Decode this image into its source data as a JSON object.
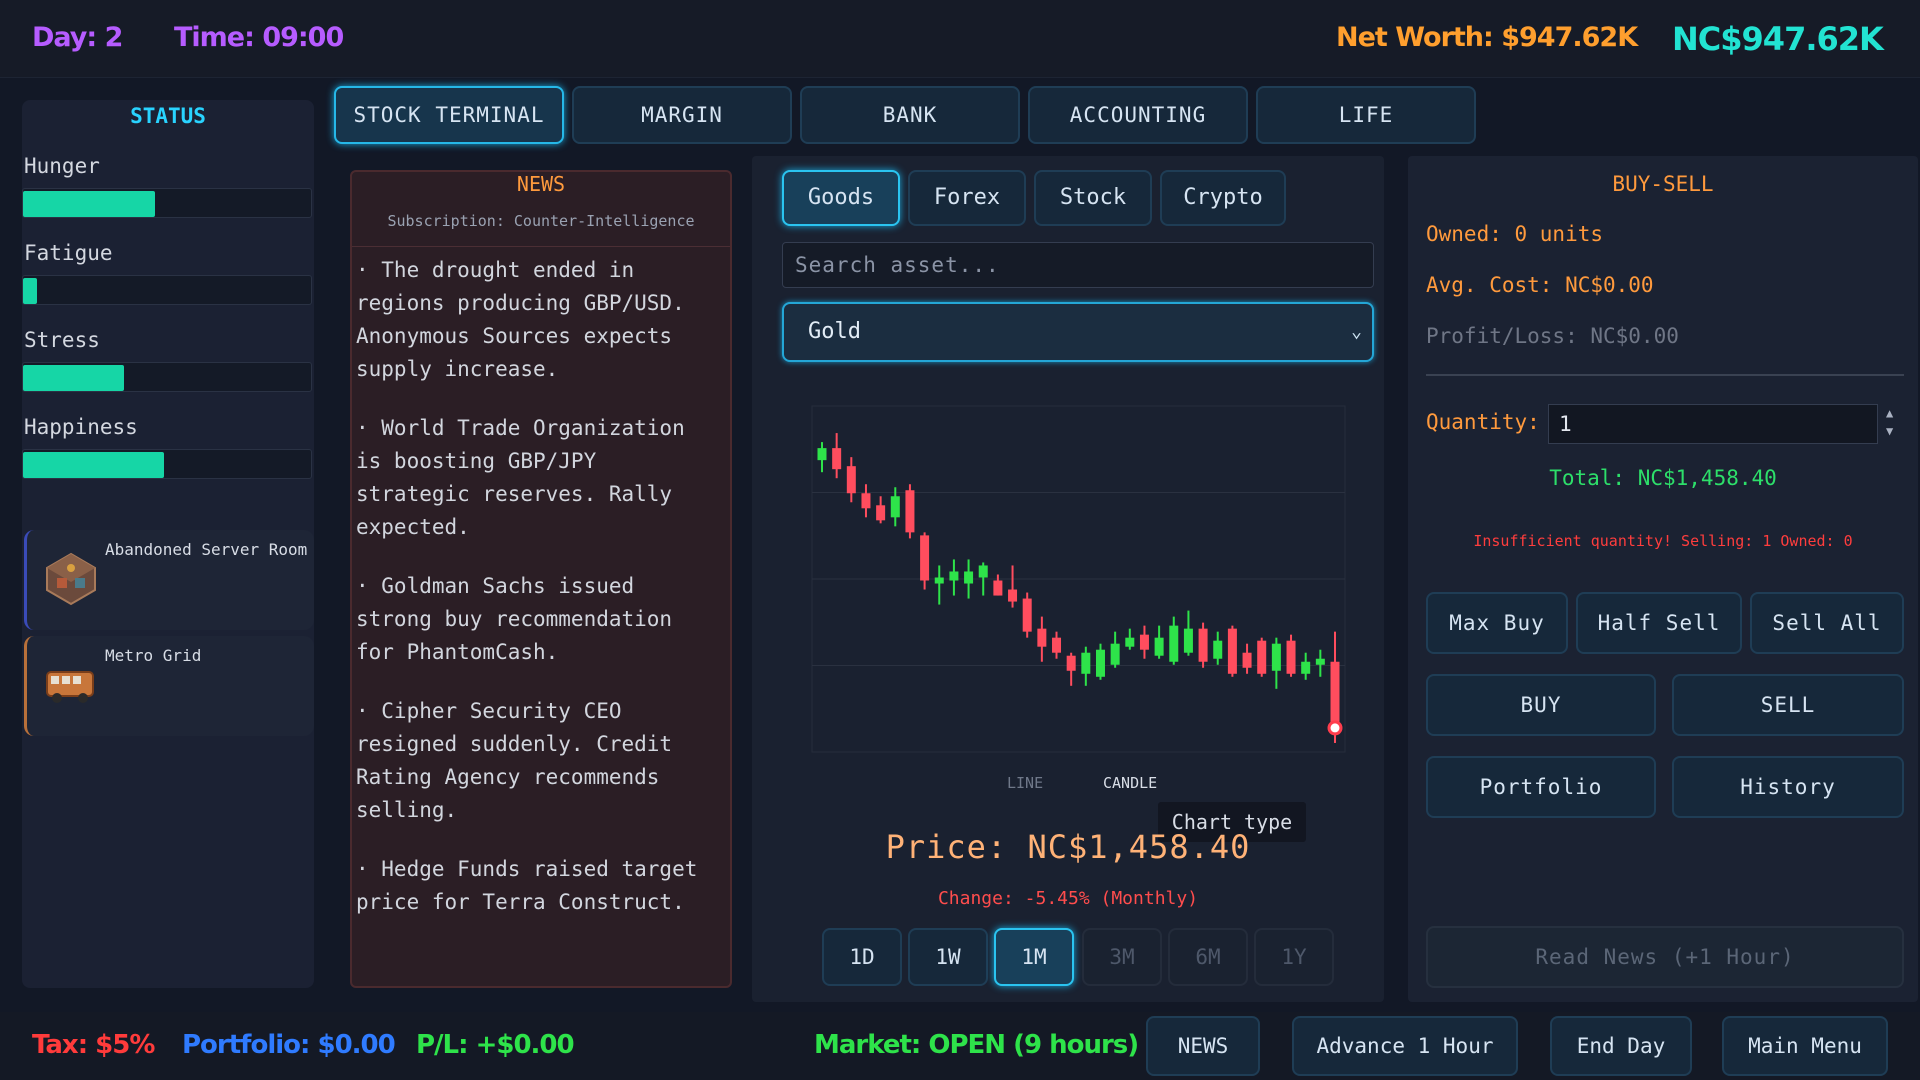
{
  "topbar": {
    "day": "Day: 2",
    "time": "Time: 09:00",
    "net_worth": "Net Worth: $947.62K",
    "nc_balance": "NC$947.62K"
  },
  "status": {
    "title": "STATUS",
    "stats": [
      {
        "label": "Hunger",
        "value": 0.46
      },
      {
        "label": "Fatigue",
        "value": 0.05
      },
      {
        "label": "Stress",
        "value": 0.35
      },
      {
        "label": "Happiness",
        "value": 0.49
      }
    ],
    "locations": [
      {
        "name": "Abandoned Server Room",
        "icon": "server-room-icon",
        "accent": "#3a4bb8"
      },
      {
        "name": "Metro Grid",
        "icon": "metro-bus-icon",
        "accent": "#b8703a"
      }
    ]
  },
  "tabs": [
    "STOCK TERMINAL",
    "MARGIN",
    "BANK",
    "ACCOUNTING",
    "LIFE"
  ],
  "news": {
    "title": "NEWS",
    "subscription": "Subscription: Counter-Intelligence",
    "items": [
      "· The drought ended in regions producing GBP/USD. Anonymous Sources expects supply increase.",
      "· World Trade Organization is boosting GBP/JPY strategic reserves. Rally expected.",
      "· Goldman Sachs issued strong buy recommendation for PhantomCash.",
      "· Cipher Security CEO resigned suddenly. Credit Rating Agency recommends selling.",
      "· Hedge Funds raised target price for Terra Construct."
    ]
  },
  "market": {
    "subtabs": [
      "Goods",
      "Forex",
      "Stock",
      "Crypto"
    ],
    "search_placeholder": "Search asset...",
    "selected_asset": "Gold",
    "chart_type_line": "LINE",
    "chart_type_candle": "CANDLE",
    "tooltip": "Chart type",
    "price": "Price: NC$1,458.40",
    "change": "Change: -5.45% (Monthly)",
    "ranges": [
      "1D",
      "1W",
      "1M",
      "3M",
      "6M",
      "1Y"
    ]
  },
  "chart_data": {
    "type": "candlestick",
    "title": "",
    "xlabel": "",
    "ylabel": "",
    "ylim": [
      1440,
      1555
    ],
    "candles": [
      {
        "o": 1537,
        "h": 1543,
        "l": 1533,
        "c": 1541
      },
      {
        "o": 1541,
        "h": 1546,
        "l": 1531,
        "c": 1534
      },
      {
        "o": 1535,
        "h": 1538,
        "l": 1523,
        "c": 1526
      },
      {
        "o": 1526,
        "h": 1529,
        "l": 1518,
        "c": 1521
      },
      {
        "o": 1522,
        "h": 1525,
        "l": 1516,
        "c": 1517
      },
      {
        "o": 1518,
        "h": 1528,
        "l": 1515,
        "c": 1525
      },
      {
        "o": 1527,
        "h": 1529,
        "l": 1511,
        "c": 1513
      },
      {
        "o": 1512,
        "h": 1513,
        "l": 1494,
        "c": 1497
      },
      {
        "o": 1496,
        "h": 1502,
        "l": 1489,
        "c": 1498
      },
      {
        "o": 1497,
        "h": 1504,
        "l": 1492,
        "c": 1500
      },
      {
        "o": 1496,
        "h": 1504,
        "l": 1491,
        "c": 1500
      },
      {
        "o": 1498,
        "h": 1503,
        "l": 1492,
        "c": 1502
      },
      {
        "o": 1497,
        "h": 1499,
        "l": 1492,
        "c": 1492
      },
      {
        "o": 1494,
        "h": 1502,
        "l": 1488,
        "c": 1490
      },
      {
        "o": 1491,
        "h": 1493,
        "l": 1478,
        "c": 1480
      },
      {
        "o": 1481,
        "h": 1485,
        "l": 1470,
        "c": 1475
      },
      {
        "o": 1478,
        "h": 1480,
        "l": 1471,
        "c": 1473
      },
      {
        "o": 1472,
        "h": 1473,
        "l": 1462,
        "c": 1467
      },
      {
        "o": 1466,
        "h": 1475,
        "l": 1462,
        "c": 1473
      },
      {
        "o": 1465,
        "h": 1476,
        "l": 1464,
        "c": 1474
      },
      {
        "o": 1469,
        "h": 1480,
        "l": 1468,
        "c": 1476
      },
      {
        "o": 1475,
        "h": 1481,
        "l": 1474,
        "c": 1478
      },
      {
        "o": 1479,
        "h": 1482,
        "l": 1471,
        "c": 1474
      },
      {
        "o": 1472,
        "h": 1482,
        "l": 1471,
        "c": 1478
      },
      {
        "o": 1470,
        "h": 1485,
        "l": 1469,
        "c": 1482
      },
      {
        "o": 1473,
        "h": 1487,
        "l": 1472,
        "c": 1481
      },
      {
        "o": 1481,
        "h": 1483,
        "l": 1468,
        "c": 1470
      },
      {
        "o": 1471,
        "h": 1480,
        "l": 1469,
        "c": 1477
      },
      {
        "o": 1481,
        "h": 1482,
        "l": 1465,
        "c": 1466
      },
      {
        "o": 1473,
        "h": 1476,
        "l": 1466,
        "c": 1468
      },
      {
        "o": 1477,
        "h": 1478,
        "l": 1465,
        "c": 1466
      },
      {
        "o": 1467,
        "h": 1478,
        "l": 1461,
        "c": 1476
      },
      {
        "o": 1477,
        "h": 1479,
        "l": 1465,
        "c": 1466
      },
      {
        "o": 1466,
        "h": 1473,
        "l": 1464,
        "c": 1470
      },
      {
        "o": 1469,
        "h": 1474,
        "l": 1465,
        "c": 1471
      },
      {
        "o": 1470,
        "h": 1480,
        "l": 1443,
        "c": 1448
      }
    ],
    "last_marker": 1448
  },
  "buysell": {
    "title": "BUY-SELL",
    "owned": "Owned: 0 units",
    "avg_cost": "Avg. Cost: NC$0.00",
    "profit_loss": "Profit/Loss: NC$0.00",
    "quantity_label": "Quantity:",
    "quantity_value": "1",
    "total": "Total: NC$1,458.40",
    "warning": "Insufficient quantity! Selling: 1 Owned: 0",
    "max_buy": "Max Buy",
    "half_sell": "Half Sell",
    "sell_all": "Sell All",
    "buy": "BUY",
    "sell": "SELL",
    "portfolio": "Portfolio",
    "history": "History",
    "read_news": "Read News (+1 Hour)"
  },
  "bottombar": {
    "tax": "Tax: $5%",
    "portfolio": "Portfolio: $0.00",
    "pl": "P/L: +$0.00",
    "market": "Market: OPEN (9 hours)",
    "news_btn": "NEWS",
    "advance_btn": "Advance 1 Hour",
    "end_day_btn": "End Day",
    "main_menu_btn": "Main Menu"
  },
  "colors": {
    "accent": "#26b8e8",
    "up": "#2ee34a",
    "down": "#ff4d5e",
    "orange": "#ff9a3d"
  }
}
